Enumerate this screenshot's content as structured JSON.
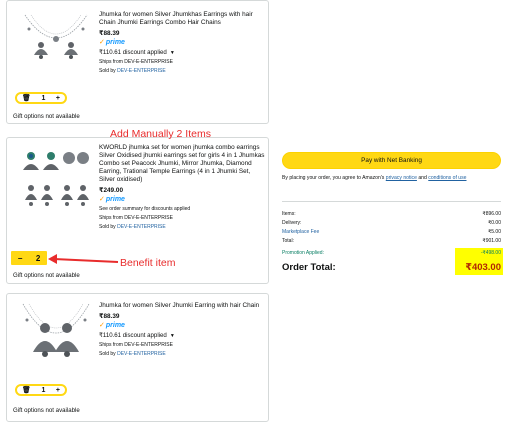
{
  "items": [
    {
      "title": "Jhumka for women Silver Jhumkhas Earrings with hair Chain Jhumki Earrings Combo Hair Chains",
      "price": "₹88.39",
      "prime": "prime",
      "discount": "₹110.61 discount applied",
      "ships_from_label": "Ships from",
      "ships_from": "DEV-E-ENTERPRISE",
      "sold_by_label": "Sold by",
      "sold_by": "DEV-E-ENTERPRISE",
      "qty": "1",
      "gift": "Gift options not available"
    },
    {
      "title": "KWORLD jhumka set for women jhumka combo earrings Silver Oxidised jhumki earrings set for girls 4 in 1 Jhumkas Combo set Peacock Jhumki, Mirror Jhumka, Diamond Earring, Trational Temple Earrings (4 in 1 Jhumki Set, Silver oxidised)",
      "price": "₹249.00",
      "prime": "prime",
      "summary_note": "See order summary for discounts applied",
      "ships_from_label": "Ships from",
      "ships_from": "DEV-E-ENTERPRISE",
      "sold_by_label": "Sold by",
      "sold_by": "DEV-E-ENTERPRISE",
      "qty": "2",
      "gift": "Gift options not available"
    },
    {
      "title": "Jhumka for women Silver Jhumki Earring with hair Chain",
      "price": "₹88.39",
      "prime": "prime",
      "discount": "₹110.61 discount applied",
      "ships_from_label": "Ships from",
      "ships_from": "DEV-E-ENTERPRISE",
      "sold_by_label": "Sold by",
      "sold_by": "DEV-E-ENTERPRISE",
      "qty": "1",
      "gift": "Gift options not available"
    }
  ],
  "annotations": {
    "add_manually": "Add Manually 2 Items",
    "benefit": "Benefit item"
  },
  "checkout": {
    "pay_button": "Pay with Net Banking",
    "terms_prefix": "By placing your order, you agree to Amazon's",
    "privacy_link": "privacy notice",
    "and": "and",
    "conditions_link": "conditions of use"
  },
  "summary": {
    "items_label": "Items:",
    "items_value": "₹896.00",
    "delivery_label": "Delivery:",
    "delivery_value": "₹0.00",
    "fee_label": "Marketplace Fee",
    "fee_value": "₹5.00",
    "total_label": "Total:",
    "total_value": "₹901.00",
    "promo_label": "Promotion Applied:",
    "promo_value": "-₹498.00",
    "order_total_label": "Order Total:",
    "order_total_value": "₹403.00"
  },
  "colors": {
    "accent_yellow": "#ffd814",
    "annotation_red": "#e82c2c",
    "highlight": "#ffff00",
    "link_blue": "#2162a1",
    "price_red": "#b12704",
    "promo_green": "#067d62"
  }
}
